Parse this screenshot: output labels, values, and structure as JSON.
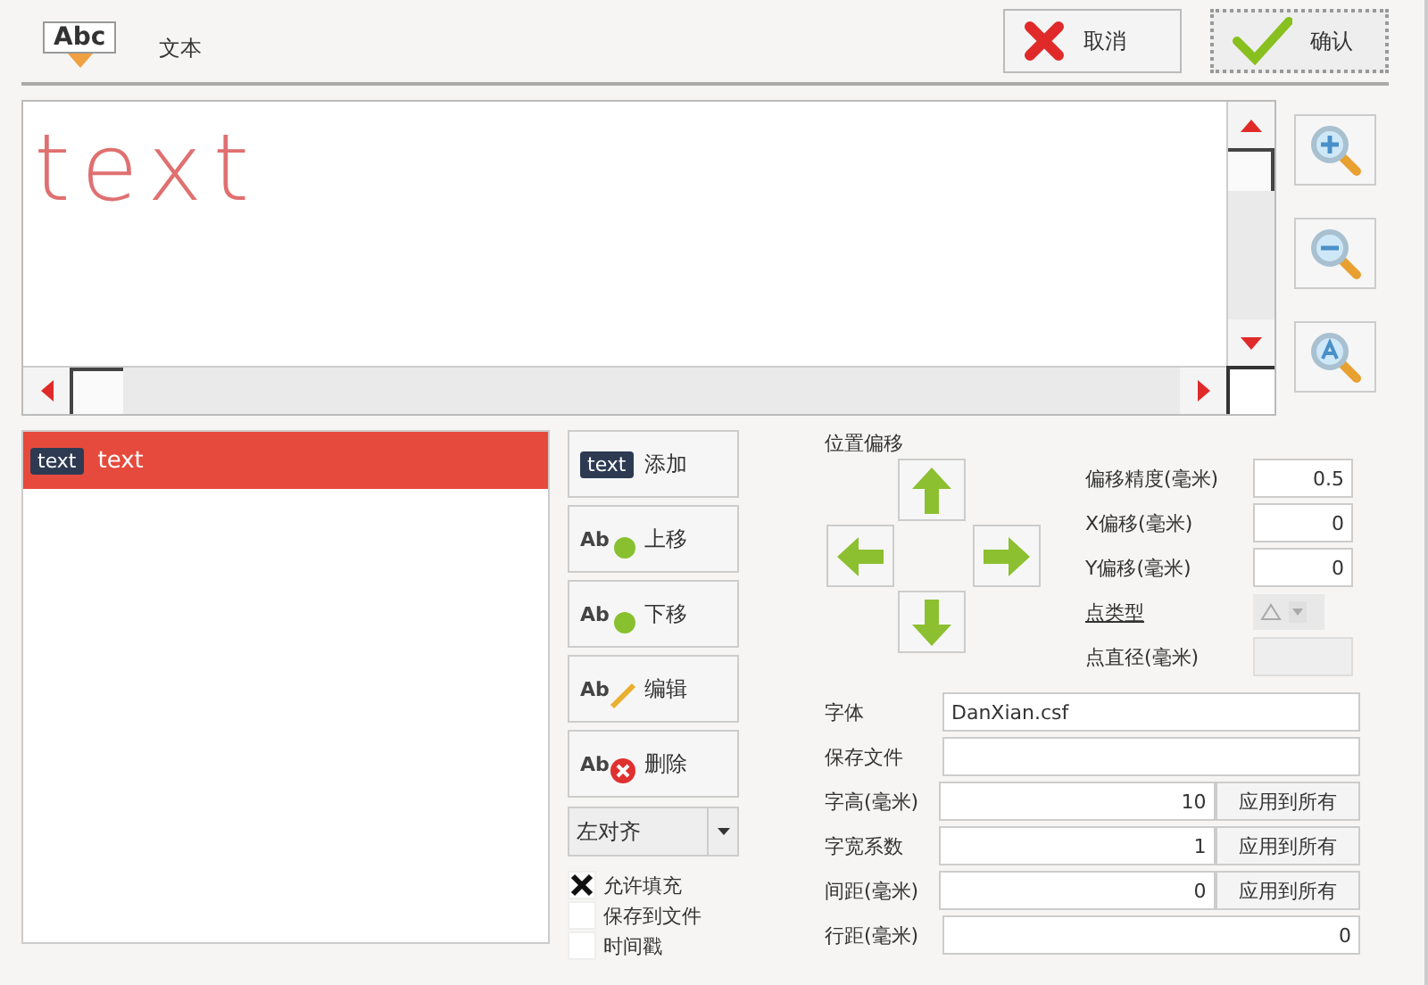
{
  "header": {
    "icon_label": "Abc",
    "title": "文本",
    "buttons": [
      {
        "kind": "cancel",
        "label": "取消"
      },
      {
        "kind": "confirm",
        "label": "确认"
      }
    ]
  },
  "canvas": {
    "preview_text": "text"
  },
  "items": [
    {
      "tag": "text",
      "label": "text",
      "selected": true
    }
  ],
  "actions": [
    {
      "kind": "add",
      "icon_text": "text",
      "label": "添加"
    },
    {
      "kind": "up",
      "icon_text": "Ab",
      "label": "上移"
    },
    {
      "kind": "down",
      "icon_text": "Ab",
      "label": "下移"
    },
    {
      "kind": "edit",
      "icon_text": "Ab",
      "label": "编辑"
    },
    {
      "kind": "delete",
      "icon_text": "Ab",
      "label": "删除"
    }
  ],
  "align": {
    "value": "左对齐"
  },
  "options": [
    {
      "label": "允许填充",
      "checked": true
    },
    {
      "label": "保存到文件",
      "checked": false
    },
    {
      "label": "时间戳",
      "checked": false
    }
  ],
  "offset": {
    "title": "位置偏移",
    "fields": [
      {
        "kind": "input",
        "label": "偏移精度(毫米)",
        "value": "0.5",
        "disabled": false
      },
      {
        "kind": "input",
        "label": "X偏移(毫米)",
        "value": "0",
        "disabled": false
      },
      {
        "kind": "input",
        "label": "Y偏移(毫米)",
        "value": "0",
        "disabled": false
      },
      {
        "kind": "combo",
        "label": "点类型",
        "disabled": true
      },
      {
        "kind": "input",
        "label": "点直径(毫米)",
        "disabled": true
      }
    ]
  },
  "font_fields": [
    {
      "label": "字体",
      "value": "DanXian.csf"
    },
    {
      "label": "保存文件"
    },
    {
      "label": "字高(毫米)",
      "value": "10",
      "apply": "应用到所有"
    },
    {
      "label": "字宽系数",
      "value": "1",
      "apply": "应用到所有"
    },
    {
      "label": "间距(毫米)",
      "value": "0",
      "apply": "应用到所有"
    },
    {
      "label": "行距(毫米)",
      "value": "0"
    }
  ]
}
